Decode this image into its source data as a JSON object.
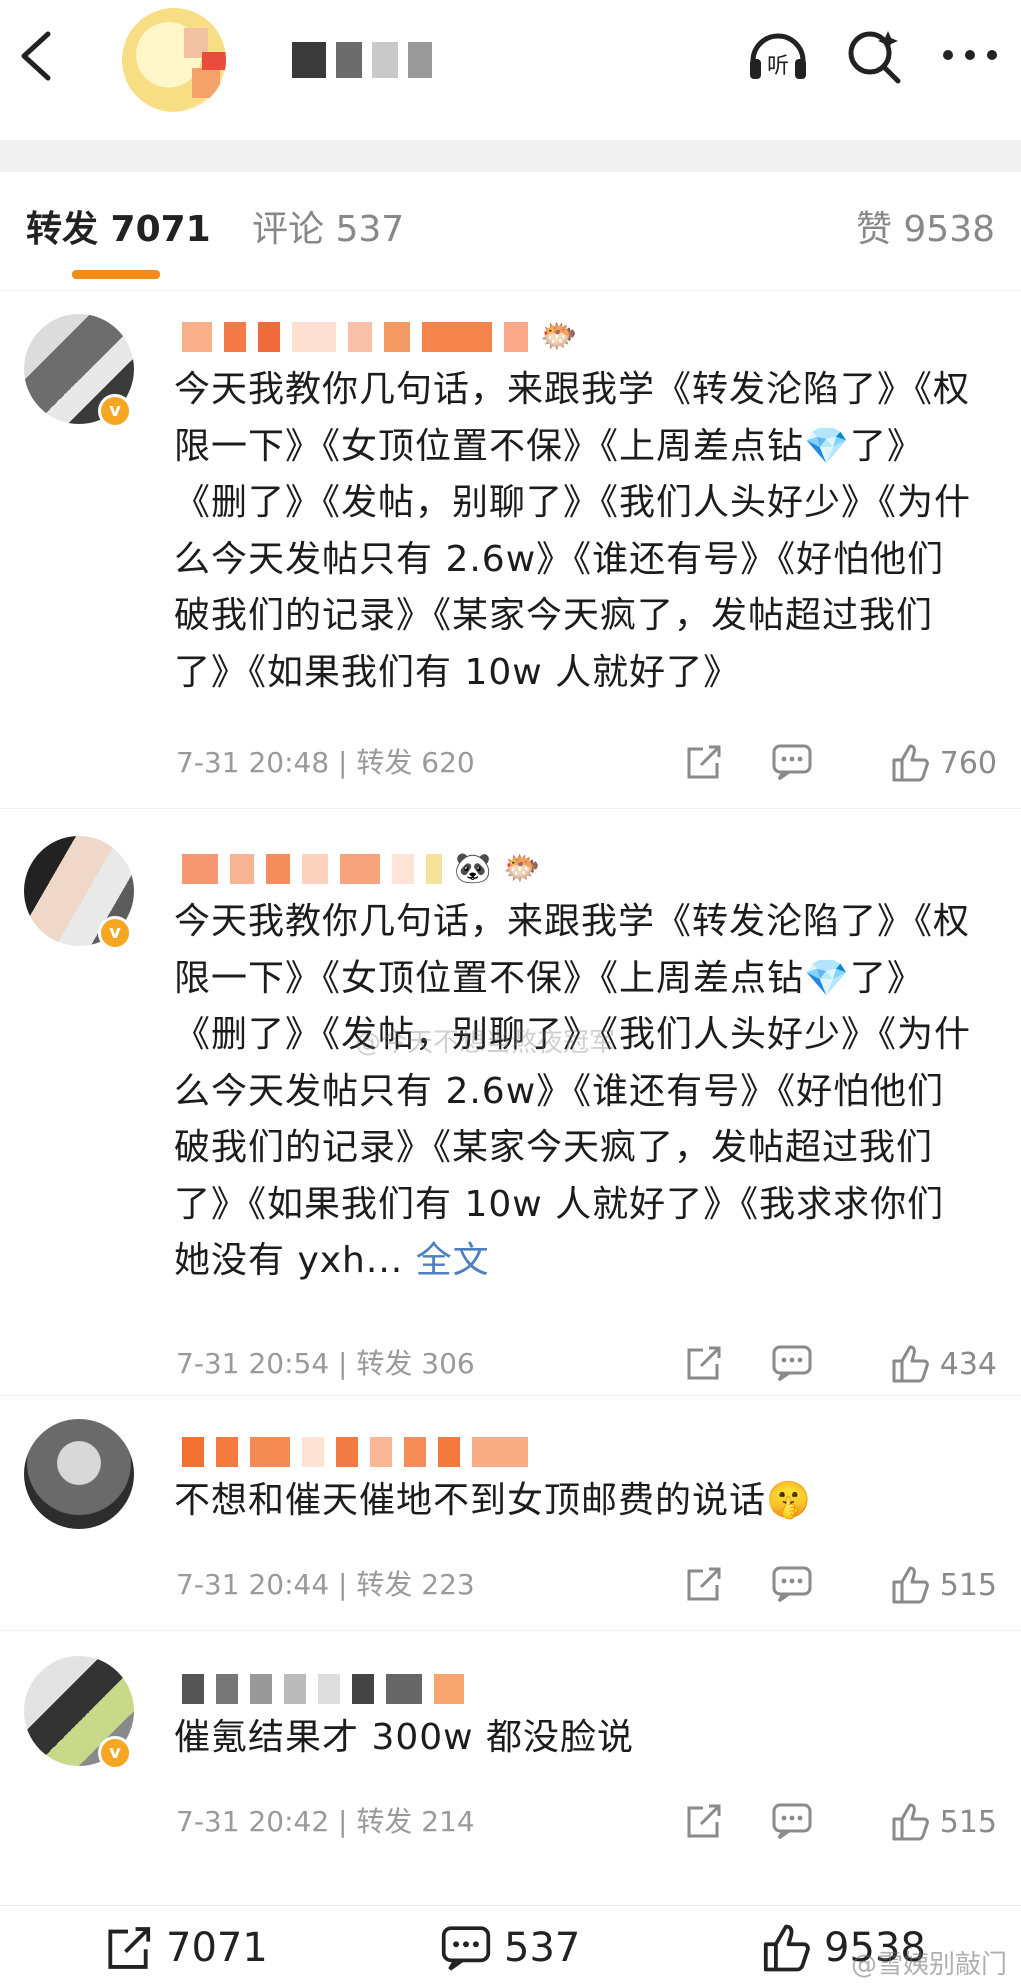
{
  "header": {
    "icons": [
      "back-icon",
      "listen-icon",
      "search-icon",
      "more-icon"
    ],
    "listen_label": "听"
  },
  "tabs": {
    "repost": "转发 7071",
    "comment": "评论 537",
    "like": "赞 9538"
  },
  "reposts": [
    {
      "text": "今天我教你几句话，来跟我学《转发沦陷了》《权限一下》《女顶位置不保》《上周差点钻💎了》《删了》《发帖，别聊了》《我们人头好少》《为什么今天发帖只有 2.6w》《谁还有号》《好怕他们破我们的记录》《某家今天疯了，发帖超过我们了》《如果我们有 10w 人就好了》",
      "meta": "7-31 20:48 | 转发 620",
      "likes": "760"
    },
    {
      "text": "今天我教你几句话，来跟我学《转发沦陷了》《权限一下》《女顶位置不保》《上周差点钻💎了》《删了》《发帖，别聊了》《我们人头好少》《为什么今天发帖只有 2.6w》《谁还有号》《好怕他们破我们的记录》《某家今天疯了，发帖超过我们了》《如果我们有 10w 人就好了》《我求求你们她没有 yxh...",
      "more": "全文",
      "meta": "7-31 20:54 | 转发 306",
      "likes": "434"
    },
    {
      "text": "不想和催天催地不到女顶邮费的说话🤫",
      "meta": "7-31 20:44 | 转发 223",
      "likes": "515"
    },
    {
      "text": "催氪结果才 300w 都没脸说",
      "meta": "7-31 20:42 | 转发 214",
      "likes": "515"
    }
  ],
  "watermark": "@今天不想当熬夜冠军",
  "watermark_bottom": "@雪姨别敲门",
  "bottom_bar": {
    "repost_count": "7071",
    "comment_count": "537",
    "like_count": "9538"
  },
  "colors": {
    "accent": "#f28b1a",
    "verified_badge": "#f5a623",
    "meta_gray": "#9a9a9a"
  }
}
